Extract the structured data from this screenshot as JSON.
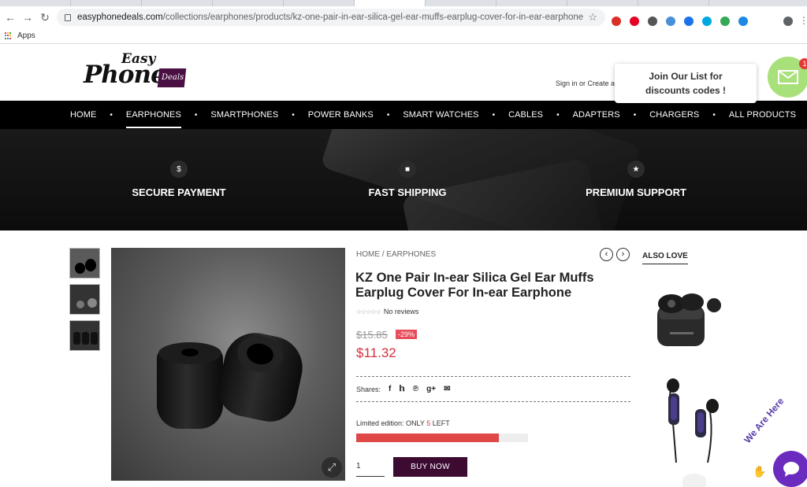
{
  "browser": {
    "url_host": "easyphonedeals.com",
    "url_path": "/collections/earphones/products/kz-one-pair-in-ear-silica-gel-ear-muffs-earplug-cover-for-in-ear-earphone",
    "bookmarks_apps_label": "Apps",
    "extension_colors": [
      "#d93025",
      "#e60023",
      "#555555",
      "#4a90d9",
      "#1a73e8",
      "#00a8e0",
      "#34a853",
      "#1e88e5"
    ]
  },
  "header": {
    "logo_easy": "Easy",
    "logo_phone": "Phone",
    "logo_deals": "Deals",
    "signin_text": "Sign in or Create an",
    "popup_text": "Join Our List for discounts codes !",
    "mail_badge": "1"
  },
  "nav": {
    "items": [
      {
        "label": "HOME",
        "active": false
      },
      {
        "label": "EARPHONES",
        "active": true
      },
      {
        "label": "SMARTPHONES",
        "active": false
      },
      {
        "label": "POWER BANKS",
        "active": false
      },
      {
        "label": "SMART WATCHES",
        "active": false
      },
      {
        "label": "CABLES",
        "active": false
      },
      {
        "label": "ADAPTERS",
        "active": false
      },
      {
        "label": "CHARGERS",
        "active": false
      },
      {
        "label": "ALL PRODUCTS",
        "active": false
      }
    ]
  },
  "banner": {
    "features": [
      {
        "icon": "dollar-icon",
        "glyph": "$",
        "label": "SECURE PAYMENT"
      },
      {
        "icon": "truck-icon",
        "glyph": "■",
        "label": "FAST SHIPPING"
      },
      {
        "icon": "star-icon",
        "glyph": "★",
        "label": "PREMIUM SUPPORT"
      }
    ]
  },
  "product": {
    "breadcrumb": "HOME / EARPHONES",
    "title": "KZ One Pair In-ear Silica Gel Ear Muffs Earplug Cover For In-ear Earphone",
    "reviews_label": "No reviews",
    "old_price": "$15.85",
    "discount": "-29%",
    "price": "$11.32",
    "shares_label": "Shares:",
    "limited_prefix": "Limited edition: ONLY ",
    "limited_count": "5",
    "limited_suffix": " LEFT",
    "stock_fraction": 0.83,
    "quantity": "1",
    "buy_label": "BUY NOW"
  },
  "sidebar": {
    "also_love_label": "ALSO LOVE"
  },
  "chat": {
    "label": "We Are Here"
  }
}
